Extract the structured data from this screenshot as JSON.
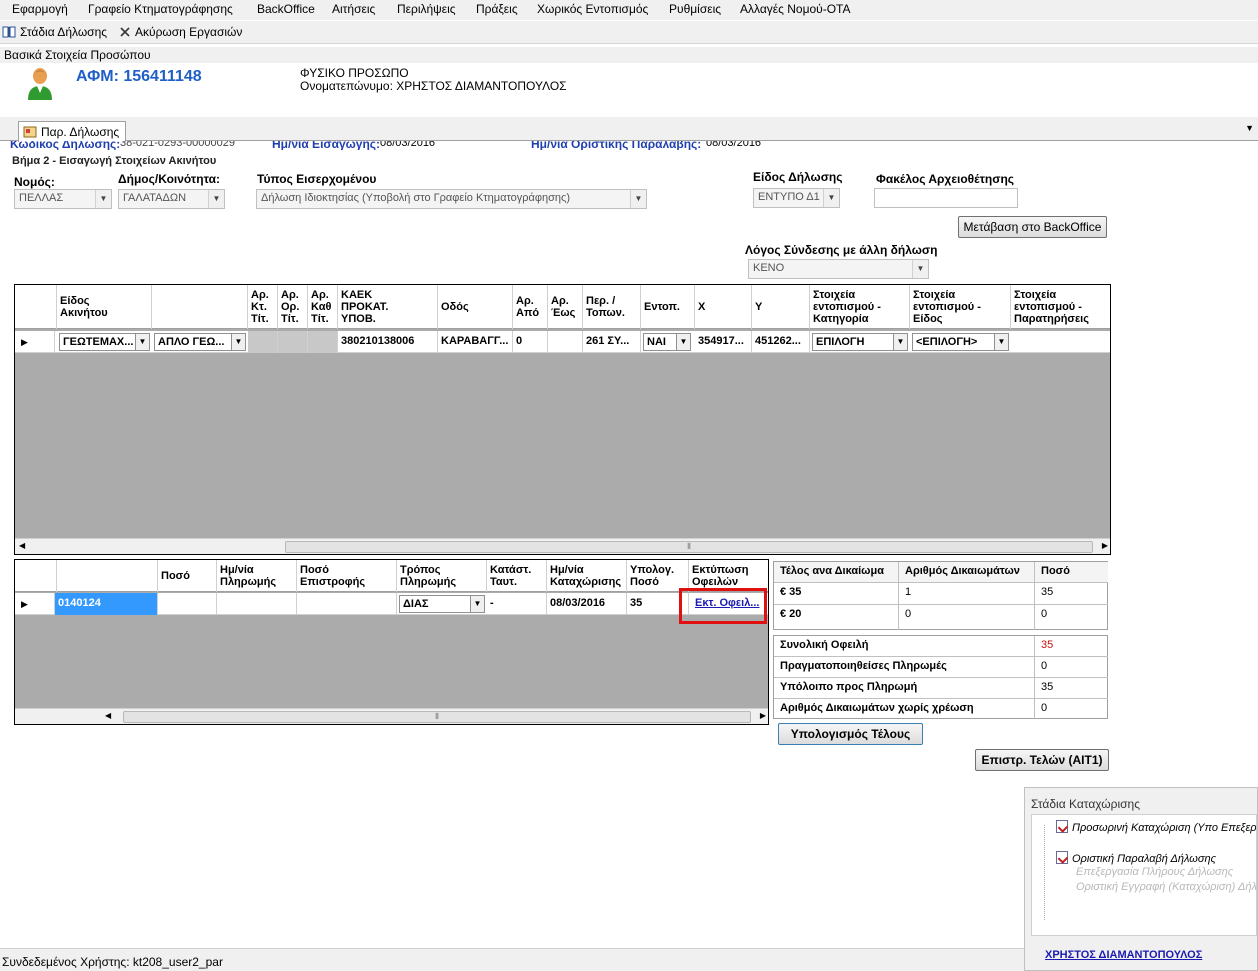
{
  "menu": [
    "Εφαρμογή",
    "Γραφείο Κτηματογράφησης",
    "BackOffice",
    "Αιτήσεις",
    "Περιλήψεις",
    "Πράξεις",
    "Χωρικός Εντοπισμός",
    "Ρυθμίσεις",
    "Αλλαγές Νομού-ΟΤΑ"
  ],
  "toolbar": {
    "stages_label": "Στάδια Δήλωσης",
    "cancel_label": "Ακύρωση Εργασιών"
  },
  "panel_header": "Βασικά Στοιχεία Προσώπου",
  "person": {
    "afm": "ΑΦΜ: 156411148",
    "type": "ΦΥΣΙΚΟ ΠΡΟΣΩΠΟ",
    "name": "Ονοματεπώνυμο: ΧΡΗΣΤΟΣ ΔΙΑΜΑΝΤΟΠΟΥΛΟΣ"
  },
  "tab": {
    "label": "Παρ. Δήλωσης"
  },
  "cut_line": {
    "code_label": "Κωδικός Δήλωσης:",
    "code_value": "38-021-0293-00000029",
    "entry_date_label": "Ημ/νία Εισαγωγής:",
    "entry_date_value": "08/03/2016",
    "final_date_label": "Ημ/νία Οριστικής Παραλαβής:",
    "final_date_value": "08/03/2016"
  },
  "step_title": "Βήμα 2 - Εισαγωγή Στοιχείων Ακινήτου",
  "form": {
    "nomos_label": "Νομός:",
    "nomos_value": "ΠΕΛΛΑΣ",
    "dimos_label": "Δήμος/Κοινότητα:",
    "dimos_value": "ΓΑΛΑΤΑΔΩΝ",
    "typos_label": "Τύπος Εισερχομένου",
    "typos_value": "Δήλωση Ιδιοκτησίας  (Υποβολή στο Γραφείο Κτηματογράφησης)",
    "eidos_label": "Είδος Δήλωσης",
    "eidos_value": "ΕΝΤΥΠΟ Δ1",
    "fakelos_label": "Φακέλος Αρχειοθέτησης",
    "fakelos_value": "",
    "backoffice_button": "Μετάβαση στο BackOffice",
    "logos_label": "Λόγος Σύνδεσης με άλλη δήλωση",
    "logos_value": "ΚΕΝΟ"
  },
  "property_grid": {
    "headers": [
      "Είδος\nΑκινήτου",
      "",
      "Αρ.\nΚτ.\nΤίτ.",
      "Αρ.\nΟρ.\nΤίτ.",
      "Αρ.\nΚαθ\nΤίτ.",
      "ΚΑΕΚ\nΠΡΟΚΑΤ.\nΥΠΟΒ.",
      "Οδός",
      "Αρ.\nΑπό",
      "Αρ.\nΈως",
      "Περ. /\nΤοπων.",
      "Εντοπ.",
      "X",
      "Y",
      "Στοιχεία\nεντοπισμού -\nΚατηγορία",
      "Στοιχεία\nεντοπισμού -\nΕίδος",
      "Στοιχεία\nεντοπισμού -\nΠαρατηρήσεις"
    ],
    "row": {
      "eidos": "ΓΕΩΤΕΜΑΧ...",
      "eidos2": "ΑΠΛΟ ΓΕΩ...",
      "kt": "",
      "or": "",
      "kath": "",
      "kaek": "380210138006",
      "odos": "ΚΑΡΑΒΑΓΓ...",
      "apo": "0",
      "eos": "",
      "perioxi": "261 ΣΥ...",
      "entop": "ΝΑΙ",
      "x": "354917...",
      "y": "451262...",
      "katigoria": "ΕΠΙΛΟΓΗ",
      "eidos_ent": "<ΕΠΙΛΟΓΗ>",
      "paratiriseis": ""
    }
  },
  "payment_grid": {
    "headers": [
      "",
      "Ποσό",
      "Ημ/νία\nΠληρωμής",
      "Ποσό\nΕπιστροφής",
      "Τρόπος\nΠληρωμής",
      "Κατάστ.\nΤαυτ.",
      "Ημ/νία\nΚαταχώρισης",
      "Υπολογ.\nΠοσό",
      "Εκτύπωση\nΟφειλών"
    ],
    "row": {
      "code": "0140124",
      "poso": "",
      "date": "",
      "epistrofi": "",
      "tropos": "ΔΙΑΣ",
      "katast": "-",
      "kataxorisi": "08/03/2016",
      "ypolog": "35",
      "print_link": "Εκτ. Οφειλ..."
    }
  },
  "fees_table": {
    "headers": [
      "Τέλος ανα Δικαίωμα",
      "Αριθμός Δικαιωμάτων",
      "Ποσό"
    ],
    "rows": [
      [
        "€ 35",
        "1",
        "35"
      ],
      [
        "€ 20",
        "0",
        "0"
      ]
    ]
  },
  "summary": [
    {
      "label": "Συνολική Οφειλή",
      "value": "35"
    },
    {
      "label": "Πραγματοποιηθείσες Πληρωμές",
      "value": "0"
    },
    {
      "label": "Υπόλοιπο προς Πληρωμή",
      "value": "35"
    },
    {
      "label": "Αριθμός Δικαιωμάτων χωρίς χρέωση",
      "value": "0"
    }
  ],
  "buttons": {
    "calc": "Υπολογισμός Τέλους",
    "refund": "Επιστρ. Τελών (ΑΙΤ1)"
  },
  "stages_panel": {
    "title": "Στάδια Καταχώρισης",
    "items": [
      "Προσωρινή Καταχώριση (Υπο Επεξεργ",
      "Οριστική Παραλαβή Δήλωσης",
      "Επεξεργασία Πλήρους Δήλωσης",
      "Οριστική Εγγραφή (Καταχώριση) Δήλ"
    ],
    "user_link": "ΧΡΗΣΤΟΣ ΔΙΑΜΑΝΤΟΠΟΥΛΟΣ"
  },
  "status": {
    "text": "Συνδεδεμένος Χρήστης: kt208_user2_par"
  },
  "colors": {
    "afm_blue": "#1f5fc7",
    "link_blue": "#1a1ab0",
    "highlight_red": "#e01010",
    "selected_cell": "#3399ff",
    "total_red": "#d01010"
  }
}
